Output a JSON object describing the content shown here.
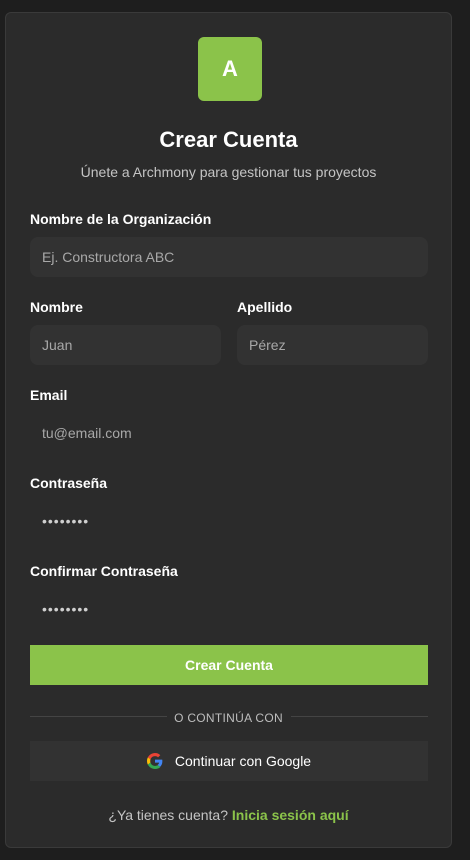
{
  "logo_letter": "A",
  "title": "Crear Cuenta",
  "subtitle": "Únete a Archmony para gestionar tus proyectos",
  "fields": {
    "organization": {
      "label": "Nombre de la Organización",
      "placeholder": "Ej. Constructora ABC"
    },
    "first_name": {
      "label": "Nombre",
      "placeholder": "Juan"
    },
    "last_name": {
      "label": "Apellido",
      "placeholder": "Pérez"
    },
    "email": {
      "label": "Email",
      "placeholder": "tu@email.com"
    },
    "password": {
      "label": "Contraseña",
      "value": "••••••••"
    },
    "confirm_password": {
      "label": "Confirmar Contraseña",
      "value": "••••••••"
    }
  },
  "submit_label": "Crear Cuenta",
  "divider_text": "O CONTINÚA CON",
  "google_label": "Continuar con Google",
  "footer": {
    "prompt": "¿Ya tienes cuenta?",
    "link": "Inicia sesión aquí"
  },
  "colors": {
    "accent": "#8bc34a",
    "card_bg": "#2b2b2b",
    "input_bg": "#323232",
    "page_bg": "#1e1e1e"
  },
  "icons": {
    "google": "google-g-icon"
  }
}
